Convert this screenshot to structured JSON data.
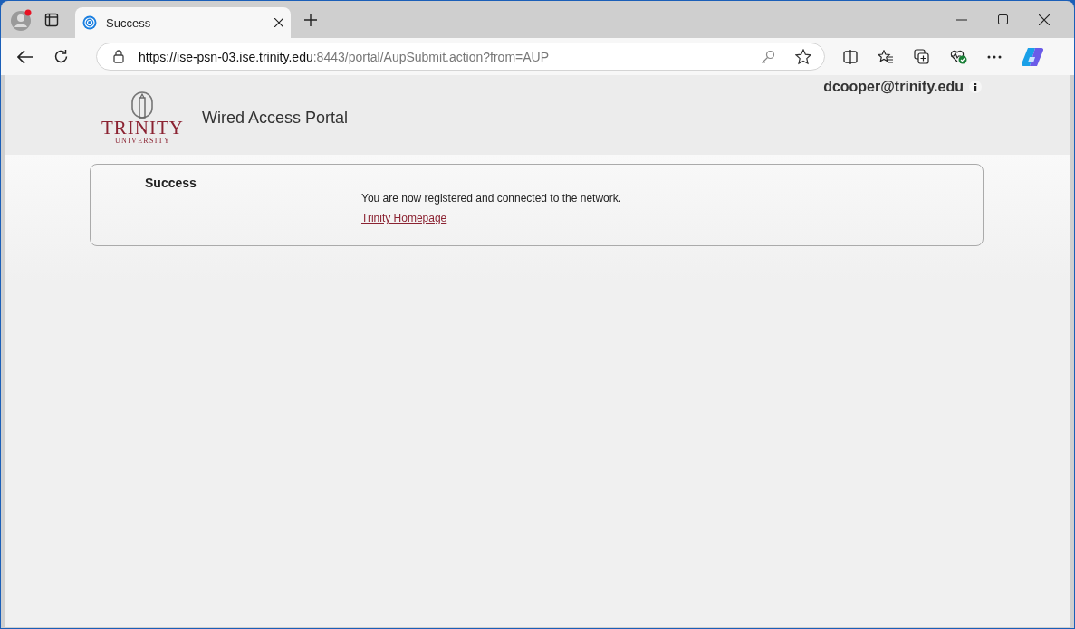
{
  "browser": {
    "tabs": [
      {
        "title": "Success",
        "selected": true
      }
    ],
    "url": {
      "host": "https://ise-psn-03.ise.trinity.edu",
      "rest": ":8443/portal/AupSubmit.action?from=AUP"
    }
  },
  "header": {
    "logo": {
      "name": "TRINITY",
      "sub": "UNIVERSITY"
    },
    "title": "Wired Access Portal",
    "user": "dcooper@trinity.edu"
  },
  "panel": {
    "heading": "Success",
    "message": "You are now registered and connected to the network.",
    "link": "Trinity Homepage"
  }
}
